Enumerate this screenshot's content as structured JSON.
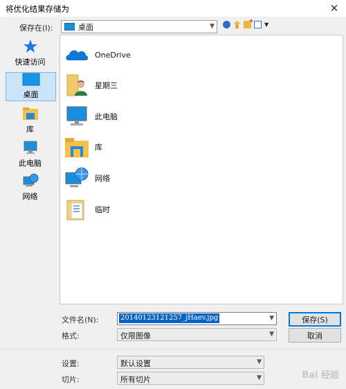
{
  "window": {
    "title": "将优化结果存储为",
    "close_glyph": "✕"
  },
  "toolbar": {
    "save_in_label": "保存在(I):",
    "location_value": "桌面"
  },
  "places": [
    {
      "label": "快速访问",
      "icon": "star-icon"
    },
    {
      "label": "桌面",
      "icon": "desktop-icon",
      "selected": true
    },
    {
      "label": "库",
      "icon": "library-icon"
    },
    {
      "label": "此电脑",
      "icon": "computer-icon"
    },
    {
      "label": "网络",
      "icon": "network-icon"
    }
  ],
  "files": [
    {
      "label": "OneDrive",
      "icon": "onedrive-icon"
    },
    {
      "label": "星期三",
      "icon": "user-folder-icon"
    },
    {
      "label": "此电脑",
      "icon": "computer-icon"
    },
    {
      "label": "库",
      "icon": "library-icon"
    },
    {
      "label": "网络",
      "icon": "network-icon"
    },
    {
      "label": "临时",
      "icon": "folder-icon"
    }
  ],
  "form": {
    "filename_label": "文件名(N):",
    "filename_value": "20140123121257_jHaev.jpg",
    "format_label": "格式:",
    "format_value": "仅限图像",
    "settings_label": "设置:",
    "settings_value": "默认设置",
    "slices_label": "切片:",
    "slices_value": "所有切片"
  },
  "buttons": {
    "save": "保存(S)",
    "cancel": "取消"
  },
  "watermark": "Bai 经验"
}
